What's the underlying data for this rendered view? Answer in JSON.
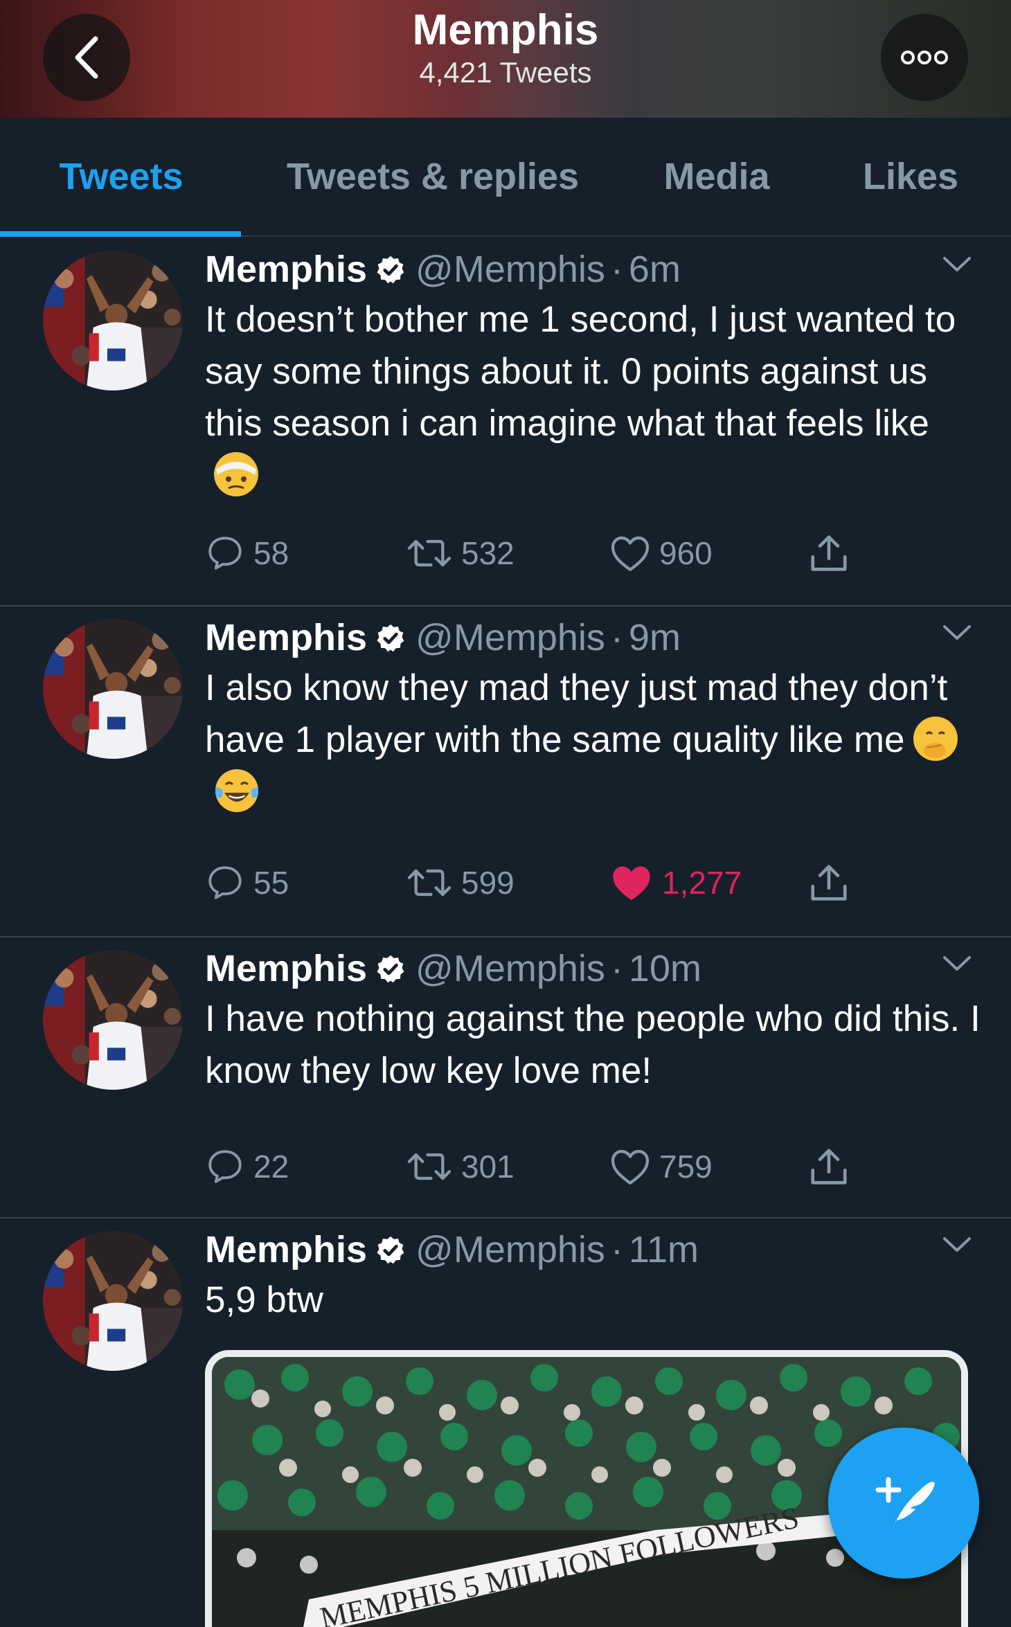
{
  "header": {
    "title": "Memphis",
    "subtitle": "4,421 Tweets"
  },
  "tabs": [
    {
      "label": "Tweets",
      "active": true
    },
    {
      "label": "Tweets & replies",
      "active": false
    },
    {
      "label": "Media",
      "active": false
    },
    {
      "label": "Likes",
      "active": false
    }
  ],
  "tweets": [
    {
      "name": "Memphis",
      "handle": "@Memphis",
      "time": "6m",
      "text": "It doesn’t bother me 1 second, I just wanted to say some things about it. 0 points against us this season i can imagine what that feels like",
      "emojis": [
        "face-with-head-bandage"
      ],
      "replies": "58",
      "retweets": "532",
      "likes": "960",
      "liked": false
    },
    {
      "name": "Memphis",
      "handle": "@Memphis",
      "time": "9m",
      "text": "I also know they mad they just mad they don’t have 1 player with the same quality like me",
      "emojis": [
        "face-with-hand-over-mouth",
        "tears-of-joy"
      ],
      "replies": "55",
      "retweets": "599",
      "likes": "1,277",
      "liked": true
    },
    {
      "name": "Memphis",
      "handle": "@Memphis",
      "time": "10m",
      "text": "I have nothing against the people who did this. I know they low key love me!",
      "emojis": [],
      "replies": "22",
      "retweets": "301",
      "likes": "759",
      "liked": false
    },
    {
      "name": "Memphis",
      "handle": "@Memphis",
      "time": "11m",
      "text": "5,9 btw",
      "emojis": [],
      "media": {
        "banner_text": "MEMPHIS 5 MILLION FOLLOWERS"
      }
    }
  ],
  "colors": {
    "background": "#15202b",
    "accent": "#1da1f2",
    "secondary_text": "#8899a6",
    "like": "#e0245e",
    "divider": "#38444d"
  },
  "icons": [
    "back-chevron-icon",
    "more-dots-icon",
    "verified-badge-icon",
    "caret-down-icon",
    "reply-icon",
    "retweet-icon",
    "heart-icon",
    "share-icon",
    "compose-tweet-icon"
  ]
}
